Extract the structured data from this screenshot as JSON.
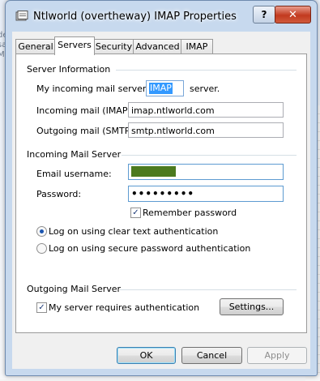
{
  "window": {
    "title": "Ntlworld (overtheway) IMAP Properties",
    "help_label": "?",
    "close_label": "✕"
  },
  "tabs": [
    {
      "label": "General"
    },
    {
      "label": "Servers"
    },
    {
      "label": "Security"
    },
    {
      "label": "Advanced"
    },
    {
      "label": "IMAP"
    }
  ],
  "server_info": {
    "title": "Server Information",
    "incoming_prefix": "My incoming mail server is a",
    "server_type": "IMAP",
    "incoming_suffix": "server.",
    "incoming_label": "Incoming mail (IMAP):",
    "incoming_value": "imap.ntlworld.com",
    "outgoing_label": "Outgoing mail (SMTP):",
    "outgoing_value": "smtp.ntlworld.com"
  },
  "incoming_server": {
    "title": "Incoming Mail Server",
    "email_label": "Email username:",
    "password_label": "Password:",
    "password_value": "•••••••••",
    "remember_label": "Remember password",
    "remember_checked": true,
    "auth_clear_label": "Log on using clear text authentication",
    "auth_secure_label": "Log on using secure password authentication",
    "selected_auth": "clear"
  },
  "outgoing_server": {
    "title": "Outgoing Mail Server",
    "requires_auth_label": "My server requires authentication",
    "requires_auth_checked": true,
    "settings_label": "Settings..."
  },
  "buttons": {
    "ok": "OK",
    "cancel": "Cancel",
    "apply": "Apply"
  },
  "check_glyph": "✓"
}
